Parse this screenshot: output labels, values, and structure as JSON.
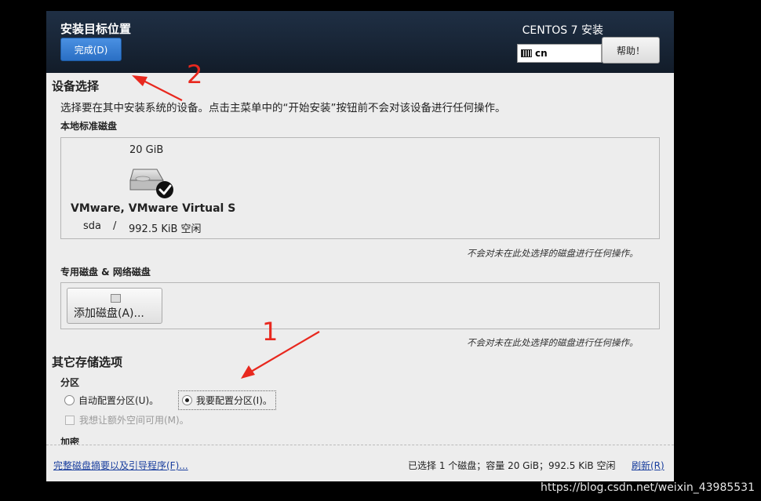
{
  "header": {
    "title": "安装目标位置",
    "done_label": "完成(D)",
    "product": "CENTOS 7 安装",
    "keyboard_layout": "cn",
    "help_label": "帮助！"
  },
  "device_selection": {
    "heading": "设备选择",
    "description": "选择要在其中安装系统的设备。点击主菜单中的“开始安装”按钮前不会对该设备进行任何操作。",
    "local_label": "本地标准磁盘",
    "disk": {
      "size": "20 GiB",
      "name": "VMware, VMware Virtual S",
      "device": "sda",
      "separator": "/",
      "free": "992.5 KiB 空闲"
    },
    "note": "不会对未在此处选择的磁盘进行任何操作。",
    "special_label": "专用磁盘 & 网络磁盘",
    "add_disk_label": "添加磁盘(A)...",
    "note2": "不会对未在此处选择的磁盘进行任何操作。"
  },
  "other_storage": {
    "heading": "其它存储选项",
    "partition_label": "分区",
    "auto_label": "自动配置分区(U)。",
    "manual_label": "我要配置分区(I)。",
    "extra_space_label": "我想让额外空间可用(M)。",
    "encryption_label": "加密",
    "selected": "manual"
  },
  "footer": {
    "summary_link": "完整磁盘摘要以及引导程序(F)...",
    "status": "已选择 1 个磁盘；容量 20 GiB；992.5 KiB 空闲",
    "refresh_label": "刷新(R)"
  },
  "annotations": {
    "arrow1_label": "1",
    "arrow2_label": "2",
    "color": "#e8281e"
  },
  "watermark": "https://blog.csdn.net/weixin_43985531",
  "colors": {
    "header_bg": "#1b2a3d",
    "accent": "#3a82d6",
    "link": "#1a3f9e"
  }
}
